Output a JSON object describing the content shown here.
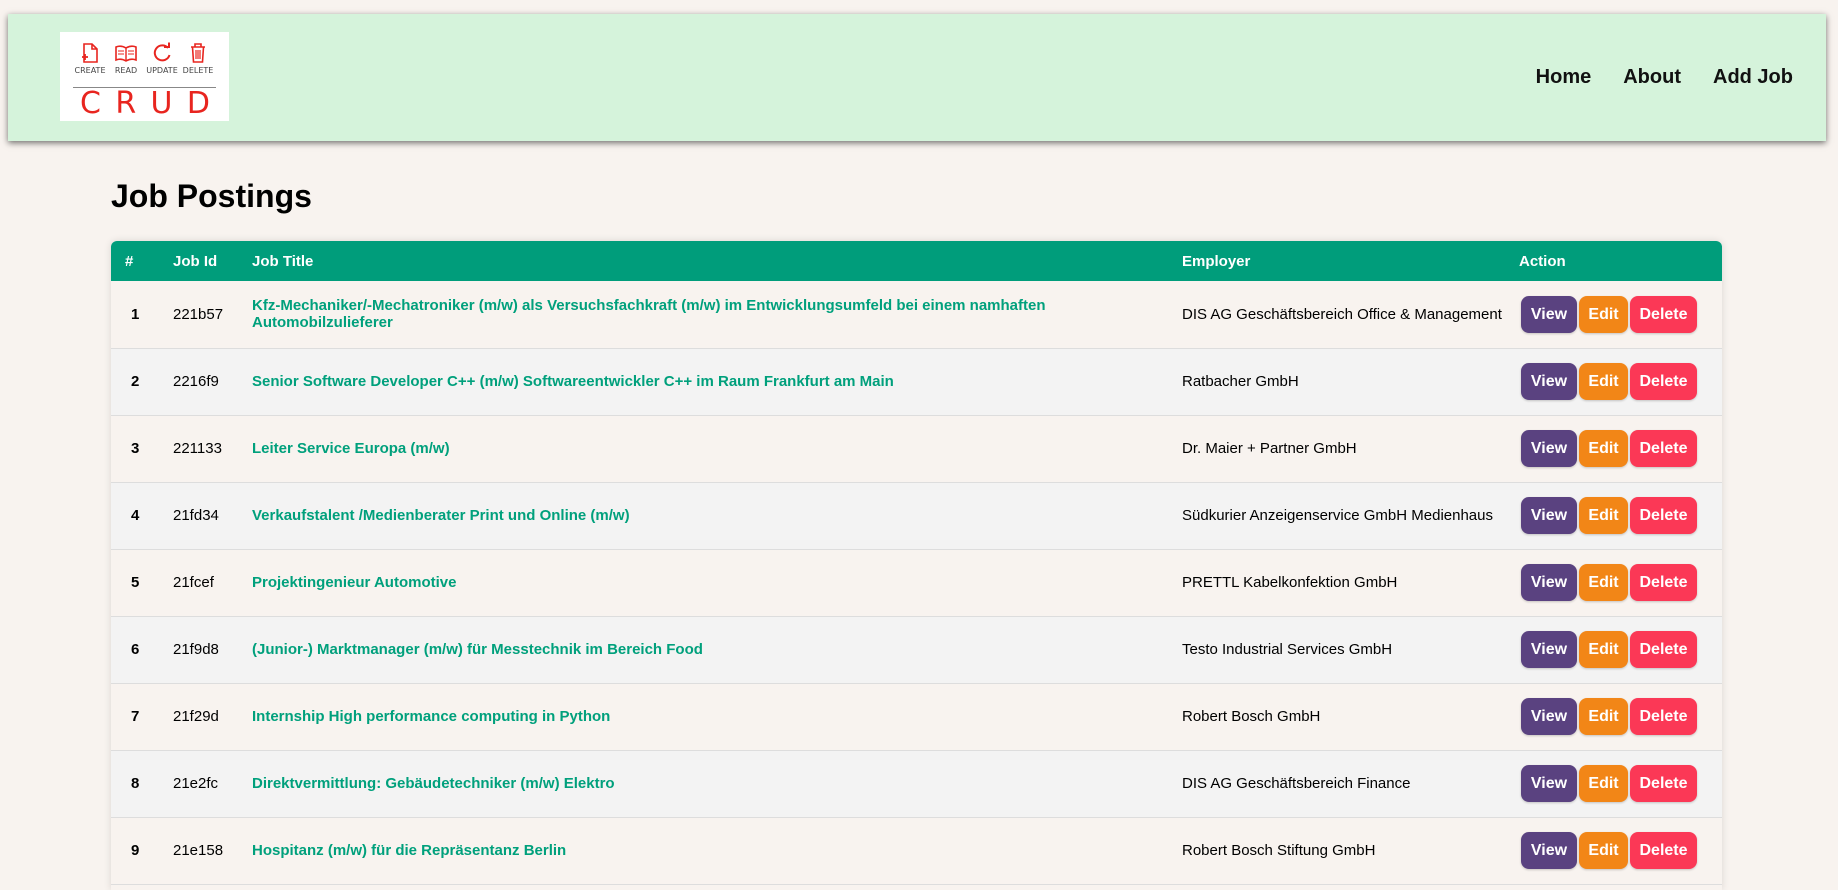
{
  "logo": {
    "captions": [
      "CREATE",
      "READ",
      "UPDATE",
      "DELETE"
    ],
    "letters": [
      "C",
      "R",
      "U",
      "D"
    ],
    "accent": "#e8251f"
  },
  "nav": {
    "home": "Home",
    "about": "About",
    "add_job": "Add Job"
  },
  "page_title": "Job Postings",
  "table": {
    "headers": {
      "num": "#",
      "job_id": "Job Id",
      "job_title": "Job Title",
      "employer": "Employer",
      "action": "Action"
    },
    "rows": [
      {
        "num": "1",
        "id": "221b57",
        "title": "Kfz-Mechaniker/-Mechatroniker (m/w) als Versuchsfachkraft (m/w) im Entwicklungsumfeld bei einem namhaften Automobilzulieferer",
        "employer": "DIS AG Geschäftsbereich Office & Management"
      },
      {
        "num": "2",
        "id": "2216f9",
        "title": "Senior Software Developer C++ (m/w) Softwareentwickler C++ im Raum Frankfurt am Main",
        "employer": "Ratbacher GmbH"
      },
      {
        "num": "3",
        "id": "221133",
        "title": "Leiter Service Europa (m/w)",
        "employer": "Dr. Maier + Partner GmbH"
      },
      {
        "num": "4",
        "id": "21fd34",
        "title": "Verkaufstalent /Medienberater Print und Online (m/w)",
        "employer": "Südkurier Anzeigenservice GmbH Medienhaus"
      },
      {
        "num": "5",
        "id": "21fcef",
        "title": "Projektingenieur Automotive",
        "employer": "PRETTL Kabelkonfektion GmbH"
      },
      {
        "num": "6",
        "id": "21f9d8",
        "title": "(Junior-) Marktmanager (m/w) für Messtechnik im Bereich Food",
        "employer": "Testo Industrial Services GmbH"
      },
      {
        "num": "7",
        "id": "21f29d",
        "title": "Internship High performance computing in Python",
        "employer": "Robert Bosch GmbH"
      },
      {
        "num": "8",
        "id": "21e2fc",
        "title": "Direktvermittlung: Gebäudetechniker (m/w) Elektro",
        "employer": "DIS AG Geschäftsbereich Finance"
      },
      {
        "num": "9",
        "id": "21e158",
        "title": "Hospitanz (m/w) für die Repräsentanz Berlin",
        "employer": "Robert Bosch Stiftung GmbH"
      }
    ],
    "actions": {
      "view": "View",
      "edit": "Edit",
      "delete": "Delete"
    }
  },
  "colors": {
    "navbar_bg": "#d5f3db",
    "header_bg": "#009d7b",
    "title_link": "#00a07c",
    "view": "#5a4280",
    "edit": "#f28617",
    "delete": "#fb3856"
  }
}
